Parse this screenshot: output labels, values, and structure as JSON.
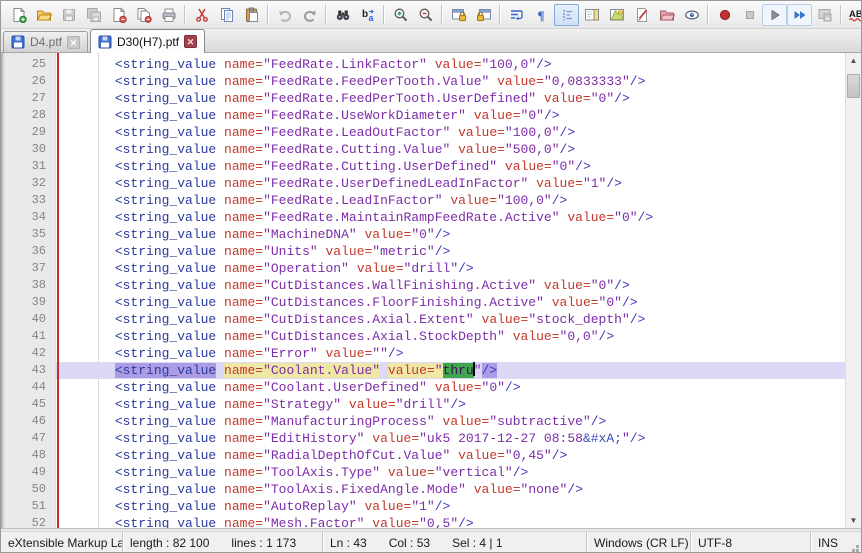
{
  "app": "Notepad++",
  "tabs": [
    {
      "label": "D4.ptf",
      "active": false
    },
    {
      "label": "D30(H7).ptf",
      "active": true
    }
  ],
  "toolbar_icons": [
    "new-file",
    "open-file",
    "save",
    "save-all",
    "close",
    "close-all",
    "print",
    "cut",
    "copy",
    "paste",
    "undo",
    "redo",
    "find",
    "replace",
    "zoom-in",
    "zoom-out",
    "sync-vertical-scrolling",
    "sync-horizontal-scrolling",
    "word-wrap",
    "show-all-characters",
    "indent-guide",
    "document-map",
    "function-list",
    "user-defined-language",
    "folder-as-workspace",
    "monitoring",
    "macro-record",
    "macro-stop",
    "macro-play",
    "macro-run-multiple",
    "macro-save",
    "spell-check"
  ],
  "editor": {
    "tag": "string_value",
    "indent": 6,
    "first_line": 25,
    "highlight": {
      "line": 43,
      "selected_text": "thru"
    },
    "lines": [
      {
        "num": 25,
        "name": "FeedRate.LinkFactor",
        "value": "100,0"
      },
      {
        "num": 26,
        "name": "FeedRate.FeedPerTooth.Value",
        "value": "0,0833333"
      },
      {
        "num": 27,
        "name": "FeedRate.FeedPerTooth.UserDefined",
        "value": "0"
      },
      {
        "num": 28,
        "name": "FeedRate.UseWorkDiameter",
        "value": "0"
      },
      {
        "num": 29,
        "name": "FeedRate.LeadOutFactor",
        "value": "100,0"
      },
      {
        "num": 30,
        "name": "FeedRate.Cutting.Value",
        "value": "500,0"
      },
      {
        "num": 31,
        "name": "FeedRate.Cutting.UserDefined",
        "value": "0"
      },
      {
        "num": 32,
        "name": "FeedRate.UserDefinedLeadInFactor",
        "value": "1"
      },
      {
        "num": 33,
        "name": "FeedRate.LeadInFactor",
        "value": "100,0"
      },
      {
        "num": 34,
        "name": "FeedRate.MaintainRampFeedRate.Active",
        "value": "0"
      },
      {
        "num": 35,
        "name": "MachineDNA",
        "value": "0"
      },
      {
        "num": 36,
        "name": "Units",
        "value": "metric"
      },
      {
        "num": 37,
        "name": "Operation",
        "value": "drill"
      },
      {
        "num": 38,
        "name": "CutDistances.WallFinishing.Active",
        "value": "0"
      },
      {
        "num": 39,
        "name": "CutDistances.FloorFinishing.Active",
        "value": "0"
      },
      {
        "num": 40,
        "name": "CutDistances.Axial.Extent",
        "value": "stock_depth"
      },
      {
        "num": 41,
        "name": "CutDistances.Axial.StockDepth",
        "value": "0,0"
      },
      {
        "num": 42,
        "name": "Error",
        "value": ""
      },
      {
        "num": 43,
        "name": "Coolant.Value",
        "value": "thru"
      },
      {
        "num": 44,
        "name": "Coolant.UserDefined",
        "value": "0"
      },
      {
        "num": 45,
        "name": "Strategy",
        "value": "drill"
      },
      {
        "num": 46,
        "name": "ManufacturingProcess",
        "value": "subtractive"
      },
      {
        "num": 47,
        "name": "EditHistory",
        "value": "uk5 2017-12-27 08:58&#xA;"
      },
      {
        "num": 48,
        "name": "RadialDepthOfCut.Value",
        "value": "0,45"
      },
      {
        "num": 49,
        "name": "ToolAxis.Type",
        "value": "vertical"
      },
      {
        "num": 50,
        "name": "ToolAxis.FixedAngle.Mode",
        "value": "none"
      },
      {
        "num": 51,
        "name": "AutoReplay",
        "value": "1"
      },
      {
        "num": 52,
        "name": "Mesh.Factor",
        "value": "0,5"
      }
    ]
  },
  "status": {
    "doc_type": "eXtensible Markup Lar",
    "length_label": "length : 82 100",
    "lines_label": "lines : 1 173",
    "ln": "Ln : 43",
    "col": "Col : 53",
    "sel": "Sel : 4 | 1",
    "eol": "Windows (CR LF)",
    "encoding": "UTF-8",
    "insert_mode": "INS"
  },
  "colors": {
    "tag": "#2B3A9C",
    "attribute": "#C3392C",
    "value": "#7C2CA8",
    "tag_end": "#4038B8",
    "current_line_bg": "#DCD8F5",
    "tag_match_bg": "#AC9CE6",
    "attr_match_bg": "#EFE8A4",
    "selection_bg": "#3EA64B",
    "margin_red_line": "#CE2B2B"
  }
}
